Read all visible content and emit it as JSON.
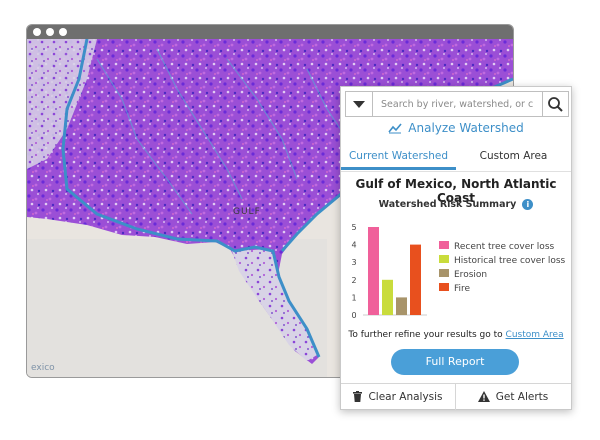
{
  "map": {
    "gulf_label": "GULF",
    "credit": "exico"
  },
  "panel": {
    "search": {
      "placeholder": "Search by river, watershed, or city"
    },
    "analyze_label": "Analyze Watershed",
    "tabs": [
      {
        "label": "Current Watershed",
        "active": true
      },
      {
        "label": "Custom Area",
        "active": false
      }
    ],
    "title": "Gulf of Mexico, North Atlantic Coast",
    "refine_text": "To further refine your results go to ",
    "refine_link": "Custom Area",
    "report_button": "Full Report",
    "footer": {
      "clear": "Clear Analysis",
      "alerts": "Get Alerts"
    }
  },
  "colors": {
    "accent": "#3d8fc8",
    "button": "#4a9fd8",
    "river": "#3d8fc8"
  },
  "chart_data": {
    "type": "bar",
    "title": "Watershed Risk Summary",
    "categories": [
      "Recent tree cover loss",
      "Historical tree cover loss",
      "Erosion",
      "Fire"
    ],
    "values": [
      5,
      2,
      1,
      4
    ],
    "colors": [
      "#f0609a",
      "#c9dc3c",
      "#a8946a",
      "#e8501e"
    ],
    "ylim": [
      0,
      5
    ],
    "yticks": [
      0,
      1,
      2,
      3,
      4,
      5
    ],
    "xlabel": "",
    "ylabel": "",
    "grid": false,
    "legend": "right"
  }
}
